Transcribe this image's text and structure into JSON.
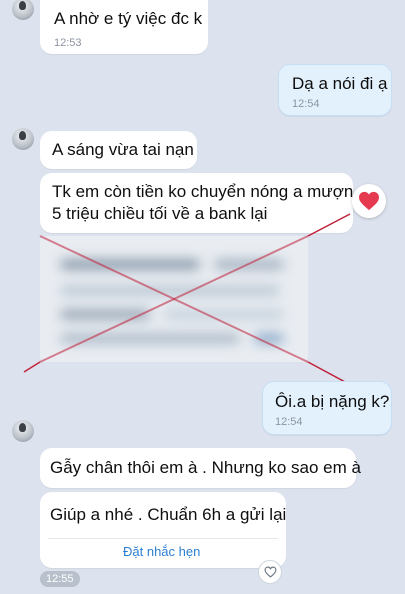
{
  "messages": [
    {
      "text": "A nhờ e tý việc đc k",
      "time": "12:53"
    },
    {
      "text": "Dạ a nói đi ạ",
      "time": "12:54"
    },
    {
      "text": "A sáng vừa tai nạn"
    },
    {
      "line1": "Tk em còn tiền ko chuyển nóng a mượn",
      "line2": "5 triệu chiều tối về a bank lại"
    },
    {
      "text": "Ôi.a bị nặng k?",
      "time": "12:54"
    },
    {
      "text": "Gẫy chân thôi em à . Nhưng ko sao em à"
    },
    {
      "text": "Giúp a nhé . Chuẩn 6h a gửi lại",
      "action": "Đặt nhắc hẹn",
      "time": "12:55"
    }
  ],
  "colors": {
    "heart": "#e53950",
    "link": "#2d7fd2",
    "mark": "#c0213b"
  }
}
